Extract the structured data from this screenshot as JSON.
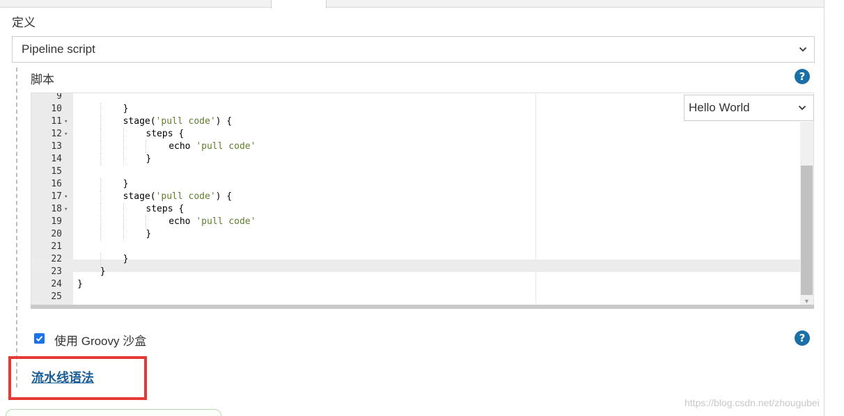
{
  "definition": {
    "label": "定义",
    "select_value": "Pipeline script"
  },
  "script": {
    "label": "脚本",
    "help": "?",
    "sample_select_value": "Hello World",
    "lines": [
      {
        "n": "9",
        "fold": "",
        "indent": 0,
        "segments": [
          {
            "t": ""
          }
        ]
      },
      {
        "n": "10",
        "fold": "",
        "indent": 2,
        "segments": [
          {
            "t": "}"
          }
        ]
      },
      {
        "n": "11",
        "fold": "▾",
        "indent": 2,
        "segments": [
          {
            "t": "stage("
          },
          {
            "t": "'pull code'",
            "s": 1
          },
          {
            "t": ") {"
          }
        ]
      },
      {
        "n": "12",
        "fold": "▾",
        "indent": 3,
        "segments": [
          {
            "t": "steps {"
          }
        ]
      },
      {
        "n": "13",
        "fold": "",
        "indent": 4,
        "segments": [
          {
            "t": "echo "
          },
          {
            "t": "'pull code'",
            "s": 1
          }
        ]
      },
      {
        "n": "14",
        "fold": "",
        "indent": 3,
        "segments": [
          {
            "t": "}"
          }
        ]
      },
      {
        "n": "15",
        "fold": "",
        "indent": 0,
        "segments": [
          {
            "t": ""
          }
        ]
      },
      {
        "n": "16",
        "fold": "",
        "indent": 2,
        "segments": [
          {
            "t": "}"
          }
        ]
      },
      {
        "n": "17",
        "fold": "▾",
        "indent": 2,
        "segments": [
          {
            "t": "stage("
          },
          {
            "t": "'pull code'",
            "s": 1
          },
          {
            "t": ") {"
          }
        ]
      },
      {
        "n": "18",
        "fold": "▾",
        "indent": 3,
        "segments": [
          {
            "t": "steps {"
          }
        ]
      },
      {
        "n": "19",
        "fold": "",
        "indent": 4,
        "segments": [
          {
            "t": "echo "
          },
          {
            "t": "'pull code'",
            "s": 1
          }
        ]
      },
      {
        "n": "20",
        "fold": "",
        "indent": 3,
        "segments": [
          {
            "t": "}"
          }
        ]
      },
      {
        "n": "21",
        "fold": "",
        "indent": 0,
        "segments": [
          {
            "t": ""
          }
        ]
      },
      {
        "n": "22",
        "fold": "",
        "indent": 2,
        "segments": [
          {
            "t": "}"
          }
        ]
      },
      {
        "n": "23",
        "fold": "",
        "indent": 1,
        "segments": [
          {
            "t": "}"
          }
        ]
      },
      {
        "n": "24",
        "fold": "",
        "indent": 0,
        "segments": [
          {
            "t": "}"
          }
        ]
      },
      {
        "n": "25",
        "fold": "",
        "indent": 0,
        "segments": [
          {
            "t": ""
          }
        ]
      }
    ]
  },
  "sandbox": {
    "checked": true,
    "label": "使用 Groovy 沙盒",
    "help": "?"
  },
  "syntax_link": "流水线语法",
  "watermark": "https://blog.csdn.net/zhougubei",
  "colors": {
    "link": "#1b5e96",
    "help_icon": "#1a6fa6",
    "highlight_box": "#e53935",
    "string": "#5f7d2a"
  }
}
